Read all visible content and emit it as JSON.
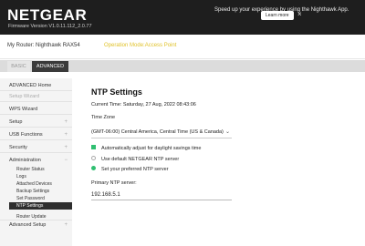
{
  "header": {
    "logo": "NETGEAR",
    "firmware": "Firmware Version V1.0.11.112_2.0.77",
    "promo": "Speed up your experience by using the Nighthawk App.",
    "learn_more": "Learn more",
    "close": "×"
  },
  "router": {
    "label": "My Router: Nighthawk RAX54",
    "mode": "Operation Mode:Access Point"
  },
  "tabs": {
    "basic": "BASIC",
    "advanced": "ADVANCED"
  },
  "sidebar": {
    "advanced_home": "ADVANCED Home",
    "setup_wizard": "Setup Wizard",
    "wps_wizard": "WPS Wizard",
    "setup": "Setup",
    "usb_functions": "USB Functions",
    "security": "Security",
    "administration": "Administration",
    "admin_items": [
      "Router Status",
      "Logs",
      "Attached Devices",
      "Backup Settings",
      "Set Password",
      "NTP Settings",
      "Router Update"
    ],
    "advanced_setup": "Advanced Setup",
    "plus": "+",
    "minus": "−"
  },
  "main": {
    "title": "NTP Settings",
    "current_time": "Current Time:  Saturday, 27 Aug, 2022 08:43:06",
    "timezone_label": "Time Zone",
    "timezone_value": "(GMT-06:00) Central America, Central Time (US & Canada)",
    "chevron": "⌄",
    "dst": "Automatically adjust for daylight savings time",
    "use_default": "Use default NETGEAR NTP server",
    "set_preferred": "Set your preferred NTP server",
    "primary_label": "Primary NTP server:",
    "primary_value": "192.168.5.1"
  },
  "colors": {
    "accent": "#2fbf71",
    "mode": "#e0c22a",
    "header": "#1e1e1e"
  }
}
